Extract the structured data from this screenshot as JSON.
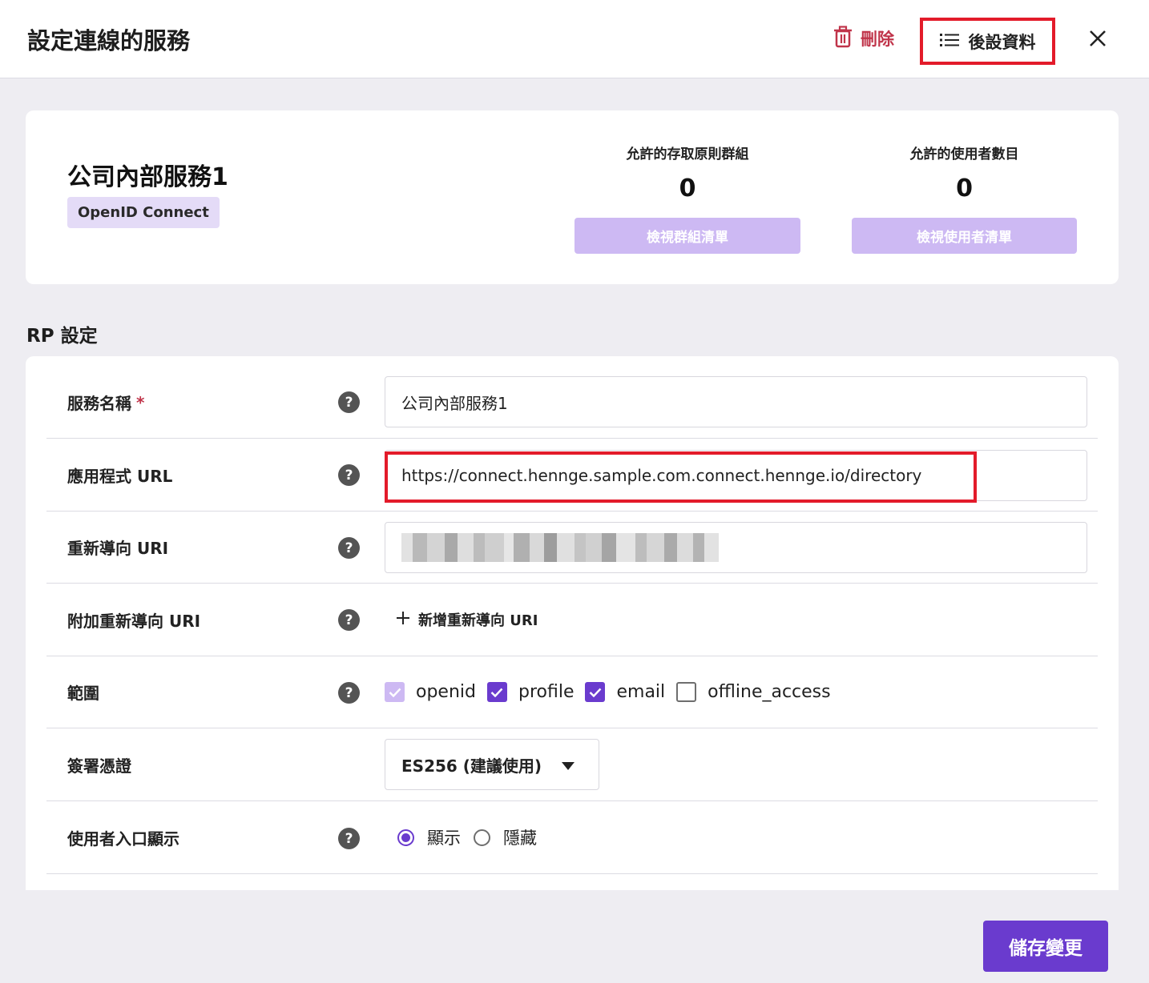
{
  "header": {
    "title": "設定連線的服務",
    "delete_label": "刪除",
    "metadata_label": "後設資料"
  },
  "summary": {
    "service_name": "公司內部服務1",
    "protocol": "OpenID Connect",
    "groups": {
      "label": "允許的存取原則群組",
      "count": "0",
      "button": "檢視群組清單"
    },
    "users": {
      "label": "允許的使用者數目",
      "count": "0",
      "button": "檢視使用者清單"
    }
  },
  "rp": {
    "section_title": "RP 設定",
    "service_name": {
      "label": "服務名稱",
      "required_mark": "*",
      "value": "公司內部服務1"
    },
    "app_url": {
      "label": "應用程式 URL",
      "value": "https://connect.hennge.sample.com.connect.hennge.io/directory"
    },
    "redirect_uri": {
      "label": "重新導向 URI"
    },
    "extra_redirect": {
      "label": "附加重新導向 URI",
      "add_label": "新增重新導向 URI"
    },
    "scope": {
      "label": "範圍",
      "options": [
        {
          "name": "openid",
          "state": "checked-disabled"
        },
        {
          "name": "profile",
          "state": "checked"
        },
        {
          "name": "email",
          "state": "checked"
        },
        {
          "name": "offline_access",
          "state": "unchecked"
        }
      ]
    },
    "signing_cert": {
      "label": "簽署憑證",
      "selected": "ES256 (建議使用)"
    },
    "portal_display": {
      "label": "使用者入口顯示",
      "options": [
        "顯示",
        "隱藏"
      ],
      "selected": "顯示"
    }
  },
  "save_label": "儲存變更",
  "colors": {
    "primary": "#6a3bce",
    "primary_light": "#cdb9f3",
    "danger": "#c0344a",
    "highlight": "#e31b2a"
  }
}
